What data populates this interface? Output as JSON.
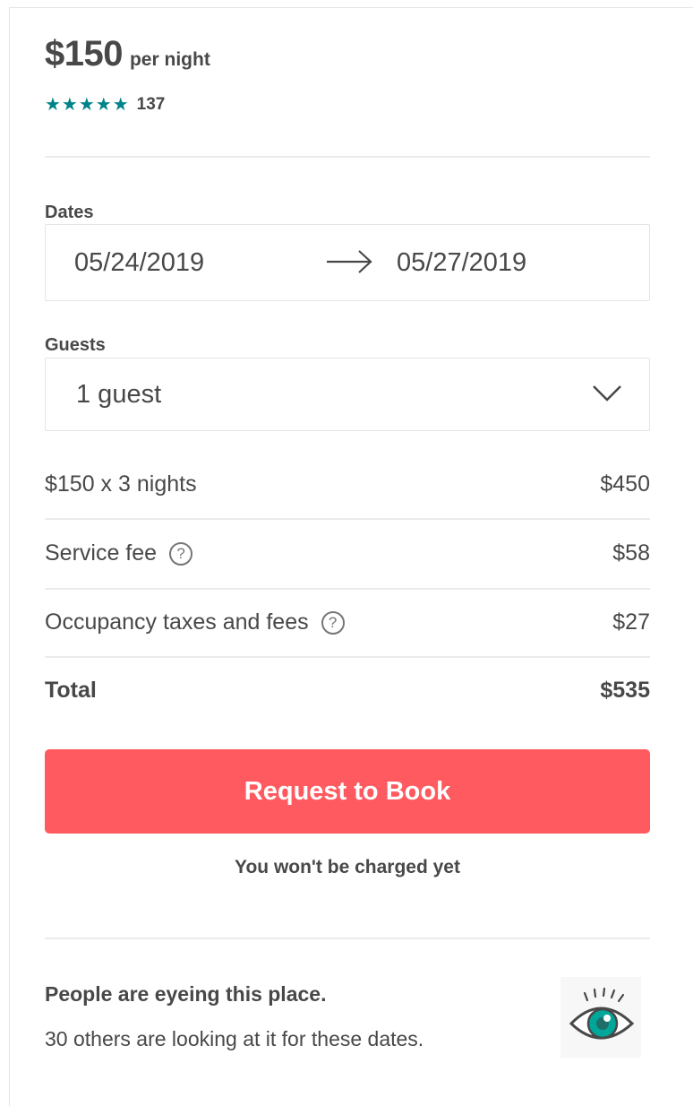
{
  "listing": {
    "price": "$150",
    "per_night": "per night",
    "stars": "★★★★★",
    "review_count": "137",
    "star_color": "#008489"
  },
  "dates": {
    "label": "Dates",
    "check_in": "05/24/2019",
    "check_out": "05/27/2019"
  },
  "guests": {
    "label": "Guests",
    "value": "1 guest"
  },
  "pricing": {
    "nights_label": "$150 x 3 nights",
    "nights_amount": "$450",
    "service_fee_label": "Service fee",
    "service_fee_amount": "$58",
    "occupancy_label": "Occupancy taxes and fees",
    "occupancy_amount": "$27",
    "total_label": "Total",
    "total_amount": "$535",
    "help_glyph": "?"
  },
  "booking": {
    "button_label": "Request to Book",
    "button_color": "#ff5a5f",
    "note": "You won't be charged yet"
  },
  "demand": {
    "title": "People are eyeing this place.",
    "subtitle": "30 others are looking at it for these dates.",
    "icon": "eye-icon"
  }
}
